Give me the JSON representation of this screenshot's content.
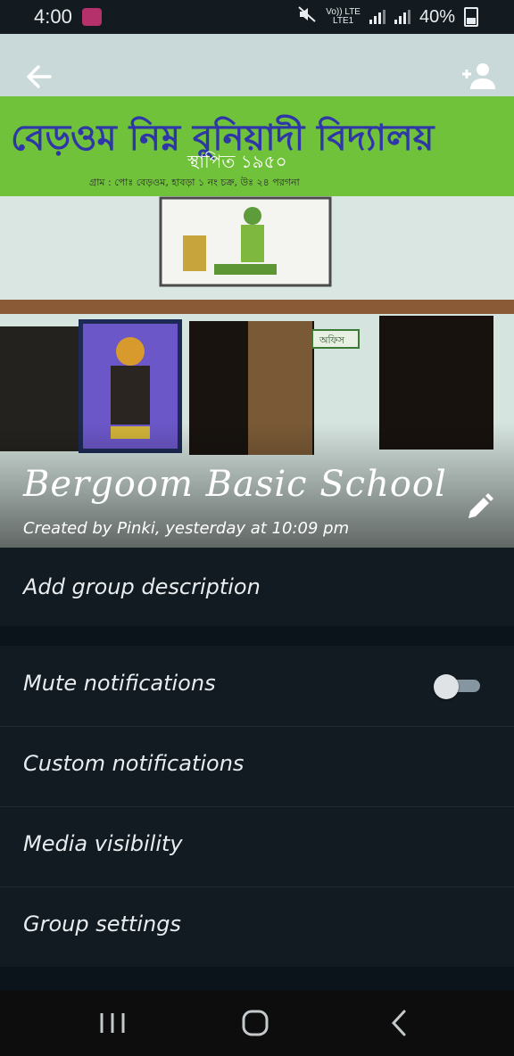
{
  "status_bar": {
    "time": "4:00",
    "network_top": "Vo)) LTE",
    "network_bottom": "LTE1",
    "battery": "40%"
  },
  "header": {
    "group_name": "Bergoom Basic School",
    "created_text": "Created by Pinki, yesterday at 10:09 pm",
    "photo_sign": "বেড়ওম নিম্ন বুনিয়াদী বিদ্যালয়",
    "photo_subsign": "স্থাপিত ১৯৫০",
    "photo_address": "গ্রাম : পোঃ বেড়ওম, হাবড়া ১ নং চক্র, উঃ ২৪ পরগনা",
    "photo_door_sign": "অফিস"
  },
  "description": {
    "label": "Add group description"
  },
  "settings": {
    "mute_label": "Mute notifications",
    "mute_on": false,
    "custom_label": "Custom notifications",
    "media_label": "Media visibility",
    "group_settings_label": "Group settings"
  },
  "colors": {
    "background": "#121b22",
    "divider": "#0b141a",
    "text": "#e9edef",
    "toggle_off": "#8696a0"
  },
  "icons": [
    "arrow-left-icon",
    "add-person-icon",
    "pencil-icon",
    "recents-icon",
    "home-icon",
    "back-chevron-icon"
  ]
}
